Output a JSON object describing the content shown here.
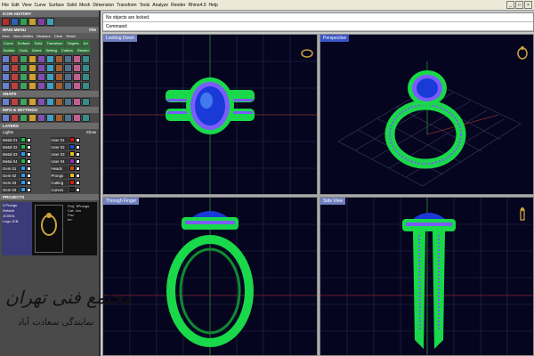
{
  "menubar": {
    "items": [
      "File",
      "Edit",
      "View",
      "Curve",
      "Surface",
      "Solid",
      "Mesh",
      "Dimension",
      "Transform",
      "Tools",
      "Analyze",
      "Render",
      "Rhino4.0",
      "Help"
    ]
  },
  "window_controls": {
    "minimize": "_",
    "maximize": "□",
    "close": "×"
  },
  "left_panel": {
    "history_title": "ICON HISTORY",
    "main_menu_title": "MAIN MENU",
    "main_menu_tab": "File",
    "main_menu_subtabs": [
      "View",
      "View Utilities",
      "Measure",
      "Clear",
      "Reset"
    ],
    "category_tags": [
      "Curve",
      "Surface",
      "Solid",
      "Transform",
      "Targets",
      "Art",
      "Builder",
      "Tools",
      "Gems",
      "Setting",
      "Cutters",
      "Render"
    ],
    "snaps_title": "SNAPS",
    "info_title": "INFO & SETTINGS",
    "layers_title": "LAYERS",
    "lights_label": "Lights",
    "show_label": "Show",
    "layers": [
      {
        "name": "Metal 01",
        "color": "#19c24a"
      },
      {
        "name": "User 01",
        "color": "#d01919"
      },
      {
        "name": "Metal 02",
        "color": "#19c24a"
      },
      {
        "name": "User 02",
        "color": "#1f4fd6"
      },
      {
        "name": "Metal 03",
        "color": "#2a9df4"
      },
      {
        "name": "User 03",
        "color": "#e8c21a"
      },
      {
        "name": "Metal 04",
        "color": "#19c24a"
      },
      {
        "name": "User 04",
        "color": "#9a2fc4"
      },
      {
        "name": "Gem 01",
        "color": "#2a9df4"
      },
      {
        "name": "Heads",
        "color": "#d04b19"
      },
      {
        "name": "Gem 02",
        "color": "#2a9df4"
      },
      {
        "name": "Prongs",
        "color": "#e8c21a"
      },
      {
        "name": "Gem 03",
        "color": "#2a9df4"
      },
      {
        "name": "Cutting",
        "color": "#d01919"
      },
      {
        "name": "Gem 04",
        "color": "#2a9df4"
      },
      {
        "name": "Curves",
        "color": "#2a2a2a"
      }
    ],
    "projects_title": "PROJECTS",
    "projects": [
      "3 Prongs",
      "Default",
      "JC0001",
      "Logo JCB"
    ],
    "project_meta": [
      "Proj: 3Prongs",
      "Cat: Jon",
      "Fav:",
      "Im:"
    ]
  },
  "command": {
    "line1": "No objects are locked.",
    "line2": "Command:"
  },
  "viewports": [
    {
      "label": "Looking Down",
      "active": false
    },
    {
      "label": "Perspective",
      "active": true
    },
    {
      "label": "Through Finger",
      "active": false
    },
    {
      "label": "Side View",
      "active": false
    }
  ],
  "watermark": {
    "line1": "مجتمع فنی تهران",
    "line2": "نمایندگی سعادت آباد"
  },
  "colors": {
    "metal": "#19d84a",
    "gem_center": "#1a3ad8",
    "accent_gems": "#7a5cff",
    "grid": "#2d2d4a",
    "background": "#050520"
  }
}
